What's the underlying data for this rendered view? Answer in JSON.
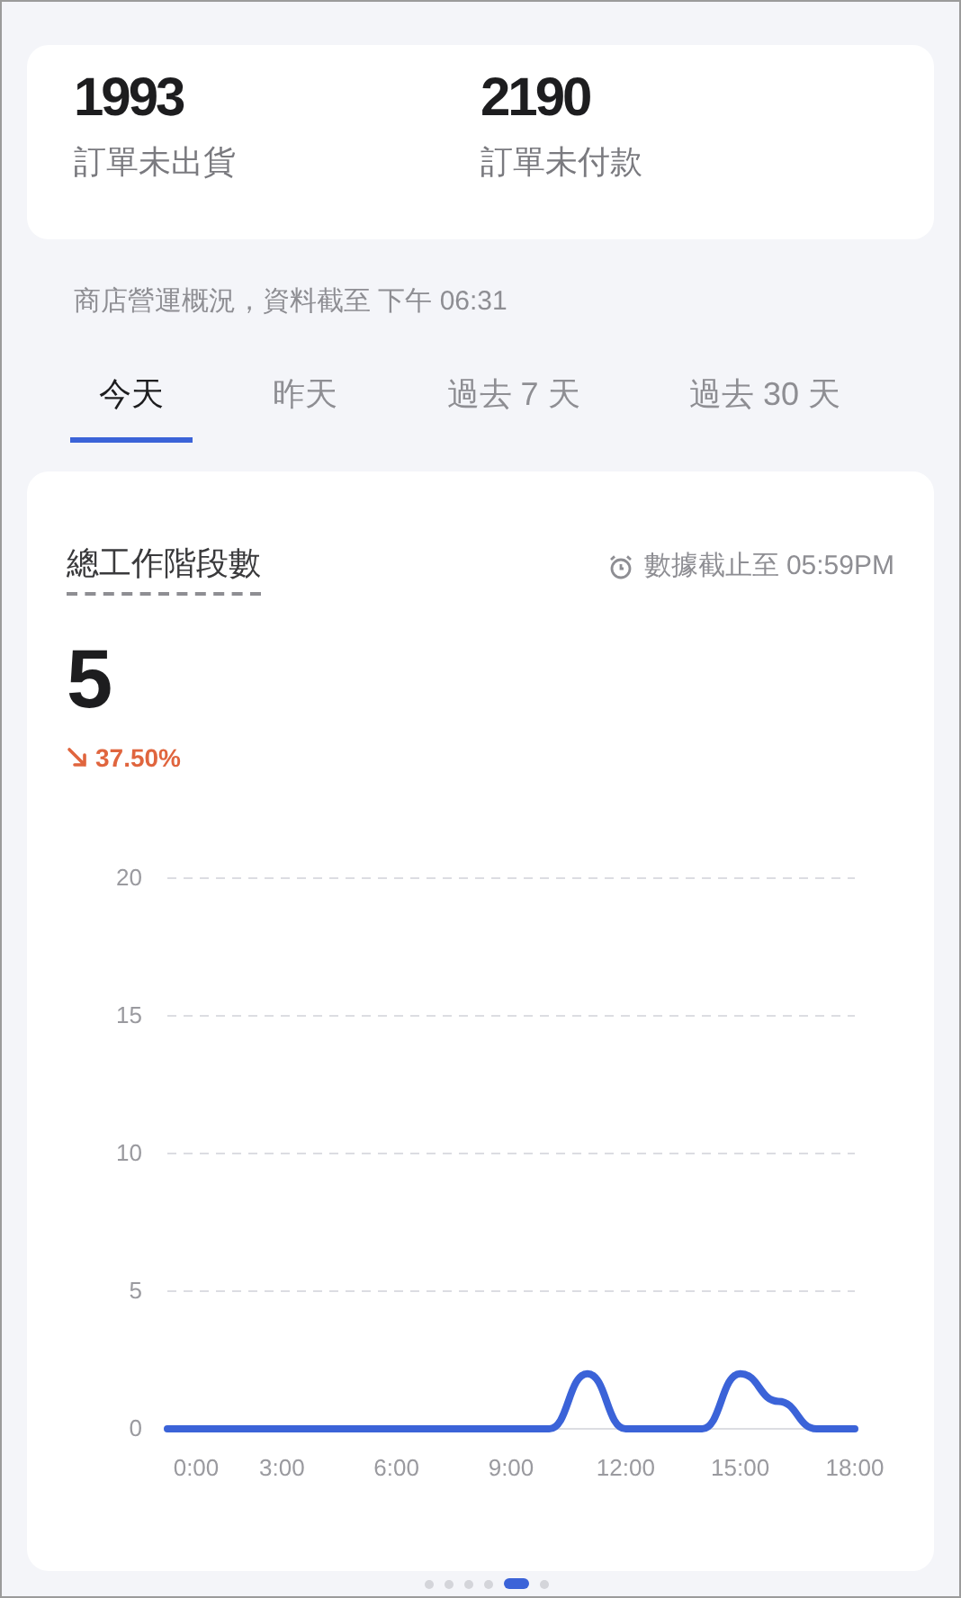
{
  "summary": [
    {
      "value": "1993",
      "label": "訂單未出貨"
    },
    {
      "value": "2190",
      "label": "訂單未付款"
    }
  ],
  "overview_note": "商店營運概況，資料截至 下午 06:31",
  "tabs": [
    {
      "label": "今天",
      "selected": true
    },
    {
      "label": "昨天",
      "selected": false
    },
    {
      "label": "過去 7 天",
      "selected": false
    },
    {
      "label": "過去 30 天",
      "selected": false
    }
  ],
  "metric": {
    "title": "總工作階段數",
    "updated": "數據截止至 05:59PM",
    "value": "5",
    "change": "37.50%",
    "falling": true,
    "chart_data": {
      "type": "line",
      "x": [
        0,
        1,
        2,
        3,
        4,
        5,
        6,
        7,
        8,
        9,
        10,
        11,
        12,
        13,
        14,
        15,
        16,
        17,
        18
      ],
      "grid": true,
      "series": [
        {
          "color": "#3b63d8",
          "values": [
            0,
            0,
            0,
            0,
            0,
            0,
            0,
            0,
            0,
            0,
            0,
            2,
            0,
            0,
            0,
            2,
            1,
            0,
            0
          ]
        }
      ],
      "xlim": [
        0,
        18
      ],
      "ylim": [
        0,
        20
      ],
      "yticks": [
        0,
        5,
        10,
        15,
        20
      ],
      "xticks": [
        {
          "value": 0,
          "label": "0:00"
        },
        {
          "value": 3,
          "label": "3:00"
        },
        {
          "value": 6,
          "label": "6:00"
        },
        {
          "value": 9,
          "label": "9:00"
        },
        {
          "value": 12,
          "label": "12:00"
        },
        {
          "value": 15,
          "label": "15:00"
        },
        {
          "value": 18,
          "label": "18:00"
        }
      ]
    }
  },
  "pager": [
    {
      "selected": false
    },
    {
      "selected": false
    },
    {
      "selected": false
    },
    {
      "selected": false
    },
    {
      "selected": true
    },
    {
      "selected": false
    }
  ]
}
